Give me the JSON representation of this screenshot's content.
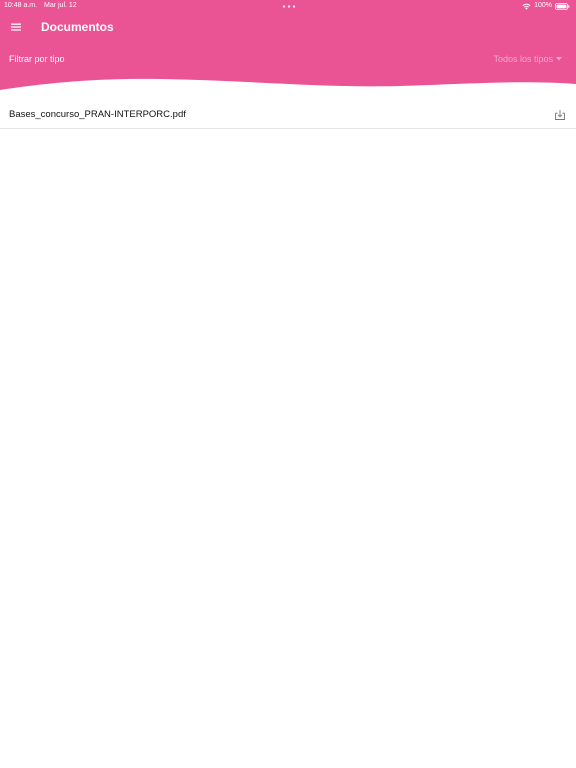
{
  "colors": {
    "header_bg": "#EA5394",
    "header_text": "#FFFFFF",
    "filter_value_text": "#F6A9CC",
    "divider": "#E4E4E4"
  },
  "status_bar": {
    "time": "10:48 a.m.",
    "date": "Mar jul. 12",
    "battery": "100%",
    "icons": [
      "multitask-dots-icon",
      "wifi-icon",
      "battery-icon"
    ]
  },
  "header": {
    "menu_icon": "hamburger-menu-icon",
    "title": "Documentos"
  },
  "filter": {
    "label": "Filtrar por tipo",
    "selected_value": "Todos los tipos",
    "dropdown_icon": "caret-down-icon"
  },
  "documents": [
    {
      "name": "Bases_concurso_PRAN-INTERPORC.pdf",
      "action_icon": "download-icon"
    }
  ]
}
